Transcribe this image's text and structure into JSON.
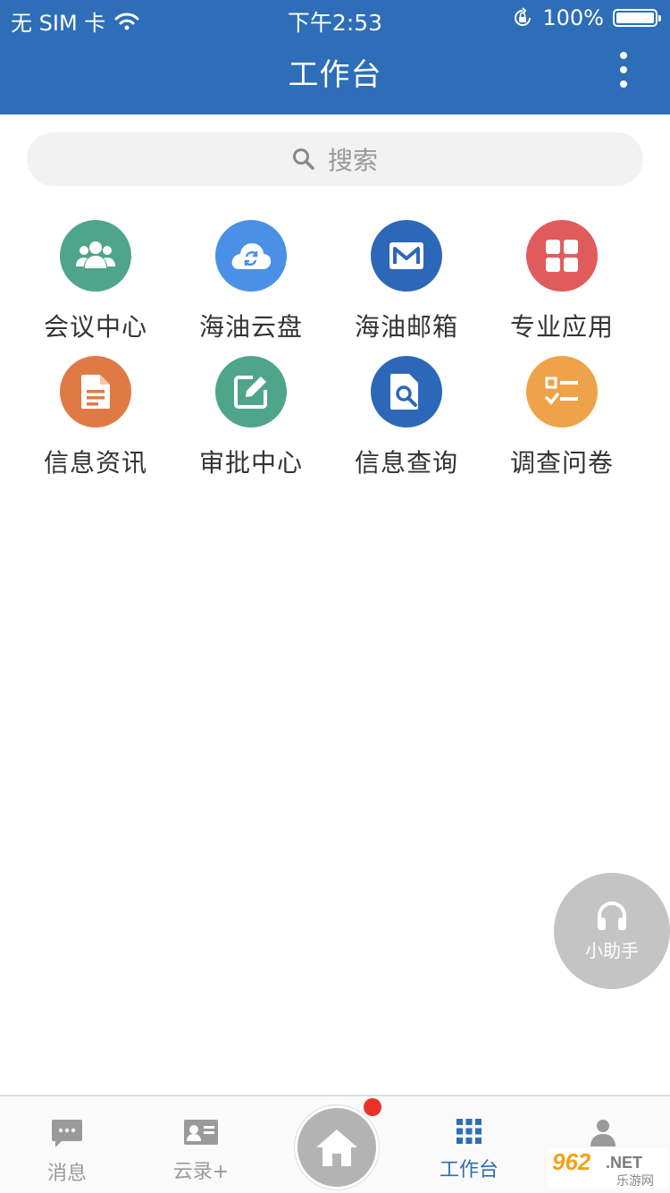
{
  "status_bar": {
    "carrier": "无 SIM 卡",
    "time": "下午2:53",
    "battery_percent": "100%",
    "battery_level": 1.0
  },
  "nav": {
    "title": "工作台",
    "more_icon": "more-vertical-icon"
  },
  "search": {
    "placeholder": "搜索",
    "icon": "search-icon"
  },
  "apps": [
    {
      "label": "会议中心",
      "icon": "meeting-icon",
      "color": "#4fa58a"
    },
    {
      "label": "海油云盘",
      "icon": "cloud-sync-icon",
      "color": "#4a90e6"
    },
    {
      "label": "海油邮箱",
      "icon": "mail-icon",
      "color": "#2d67b8"
    },
    {
      "label": "专业应用",
      "icon": "apps-grid-icon",
      "color": "#e05c5c"
    },
    {
      "label": "信息资讯",
      "icon": "document-icon",
      "color": "#e07a45"
    },
    {
      "label": "审批中心",
      "icon": "edit-icon",
      "color": "#4fa58a"
    },
    {
      "label": "信息查询",
      "icon": "file-search-icon",
      "color": "#2d67b8"
    },
    {
      "label": "调查问卷",
      "icon": "checklist-icon",
      "color": "#eea24a"
    }
  ],
  "assistant": {
    "label": "小助手",
    "icon": "headset-icon"
  },
  "tabbar": {
    "items": [
      {
        "label": "消息",
        "icon": "message-icon"
      },
      {
        "label": "云录+",
        "icon": "contact-card-icon"
      },
      {
        "label": "",
        "icon": "home-icon"
      },
      {
        "label": "工作台",
        "icon": "grid-icon",
        "active": true
      },
      {
        "label": "",
        "icon": "profile-icon"
      }
    ]
  },
  "colors": {
    "primary": "#2e6db7",
    "badge": "#e8322b"
  },
  "watermark": {
    "text": "962.NET",
    "sub": "乐游网"
  }
}
